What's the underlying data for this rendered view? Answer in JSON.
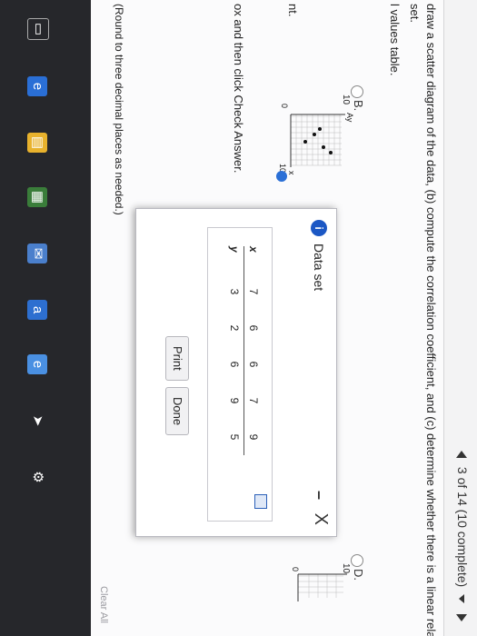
{
  "header": {
    "progress_text": "3 of 14 (10 complete)"
  },
  "question": {
    "line1": "draw a scatter diagram of the data, (b) compute the correlation coefficient, and (c) determine whether there is a linear relation b",
    "line2": "set.",
    "line3": "l values table."
  },
  "options": {
    "b_label": "B.",
    "d_label": "D.",
    "b_axis_top": "10",
    "b_axis_y": "Ay",
    "b_axis_x": "x",
    "b_axis_bottom": "10",
    "b_axis_zero": "0",
    "d_axis_top": "10",
    "d_axis_zero": "0"
  },
  "left_texts": {
    "nt": "nt.",
    "round_note": "(Round to three decimal places as needed.)",
    "instruction": "ox and then click Check Answer."
  },
  "dialog": {
    "title": "Data set",
    "minimize": "–",
    "close": "X",
    "info": "i",
    "table": {
      "x_header": "x",
      "y_header": "y",
      "x_values": [
        "7",
        "6",
        "6",
        "7",
        "9"
      ],
      "y_values": [
        "3",
        "2",
        "6",
        "9",
        "5"
      ]
    },
    "print_label": "Print",
    "done_label": "Done"
  },
  "footer": {
    "clear_all": "Clear All"
  }
}
